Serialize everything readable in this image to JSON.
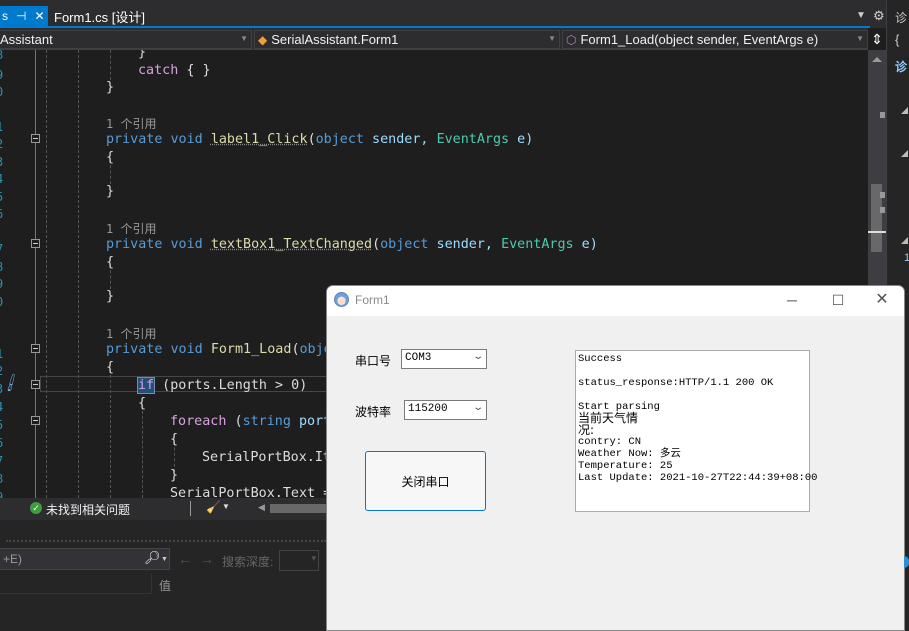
{
  "tabs": {
    "prev_tab_pin": "⊣",
    "prev_tab_close": "✕",
    "active_tab": "Form1.cs [设计]",
    "menu_icon": "dropdown-arrow",
    "settings_icon": "gear"
  },
  "navbar": {
    "project": "Assistant",
    "class": "SerialAssistant.Form1",
    "member": "Form1_Load(object sender, EventArgs e)"
  },
  "code": {
    "line_numbers": [
      "8",
      "9",
      "0",
      "1",
      "2",
      "3",
      "4",
      "5",
      "6",
      "7",
      "8",
      "9",
      "0",
      "1",
      "2",
      "3",
      "4",
      "5",
      "6",
      "7",
      "8",
      "9",
      "0"
    ],
    "codelens": [
      "1 个引用",
      "1 个引用",
      "1 个引用"
    ],
    "lines": {
      "brace_top": "}",
      "catch": "catch",
      "catch_body": " { }",
      "close1": "}",
      "m1_sig_name": "label1_Click",
      "m2_sig_name": "textBox1_TextChanged",
      "m3_sig_name": "Form1_Load",
      "private": "private",
      "void": "void",
      "object": "object",
      "sender": " sender, ",
      "eventargs": "EventArgs",
      "e": " e)",
      "open_brace": "{",
      "close_brace": "}",
      "m3_truncated": "obje",
      "if_kw": "if",
      "if_rest": " (ports.Length > 0)",
      "foreach_kw": "foreach",
      "foreach_paren": " (",
      "string_kw": "string",
      "foreach_rest": " port",
      "items_line": "SerialPortBox.It",
      "text_line": "SerialPortBox.Text ="
    }
  },
  "status": {
    "issues": "未找到相关问题"
  },
  "watch": {
    "search_placeholder": "+E)",
    "depth_label": "搜索深度:",
    "value_header": "值"
  },
  "right_panel": {
    "title_char": "诊",
    "brace_char": "{",
    "tab_char": "诊",
    "line_char": "1"
  },
  "form1": {
    "title": "Form1",
    "port_label": "串口号",
    "port_value": "COM3",
    "baud_label": "波特率",
    "baud_value": "115200",
    "close_button": "关闭串口",
    "output_lines": [
      "Success",
      "",
      "status_response:HTTP/1.1 200 OK",
      "",
      "Start parsing",
      "当前天气情",
      "况:",
      "contry: CN",
      "Weather Now: 多云",
      "Temperature: 25",
      "Last Update: 2021-10-27T22:44:39+08:00"
    ]
  }
}
